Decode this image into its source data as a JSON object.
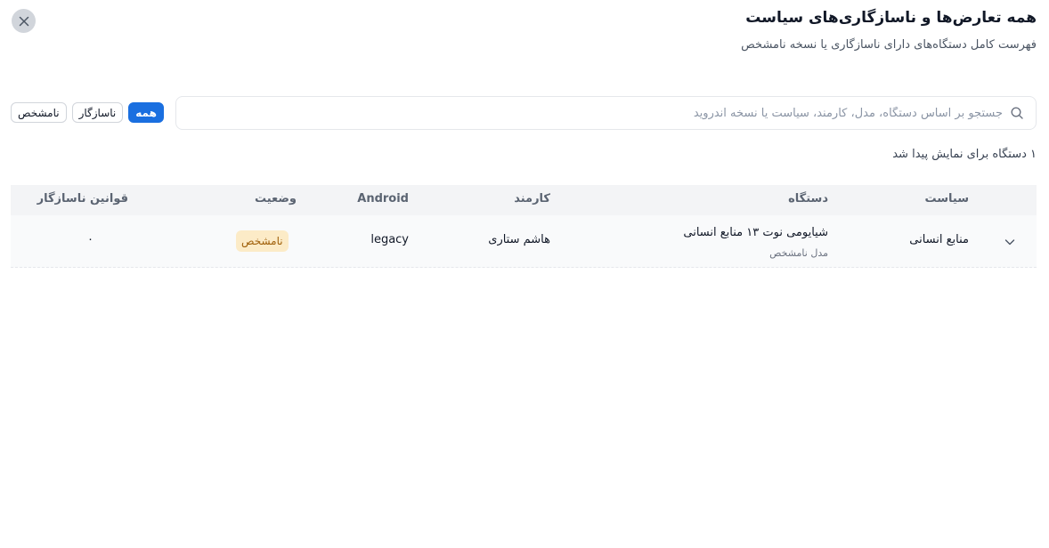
{
  "dialog": {
    "title": "همه تعارض‌ها و ناسازگاری‌های سیاست",
    "subtitle": "فهرست کامل دستگاه‌های دارای ناسازگاری یا نسخه نامشخص"
  },
  "search": {
    "placeholder": "جستجو بر اساس دستگاه، مدل، کارمند، سیاست یا نسخه اندروید",
    "value": ""
  },
  "filters": [
    {
      "label": "همه",
      "active": true
    },
    {
      "label": "ناسازگار",
      "active": false
    },
    {
      "label": "نامشخص",
      "active": false
    }
  ],
  "result_count": "۱ دستگاه برای نمایش پیدا شد",
  "table": {
    "columns": {
      "policy": "سیاست",
      "device": "دستگاه",
      "employee": "کارمند",
      "android": "Android",
      "status": "وضعیت",
      "rules": "قوانین ناسازگار"
    },
    "rows": [
      {
        "policy": "منابع انسانی",
        "device": "شیایومی نوت ۱۳ منابع انسانی",
        "model": "مدل نامشخص",
        "employee": "هاشم ستاری",
        "android": "legacy",
        "status": "نامشخص",
        "rules": "۰"
      }
    ]
  },
  "icons": {
    "close": "close-icon",
    "search": "search-icon",
    "expand": "chevron-down-icon"
  },
  "colors": {
    "accent": "#1a6fe0",
    "status_unknown_bg": "#fcebc7",
    "status_unknown_text": "#a0600a"
  }
}
